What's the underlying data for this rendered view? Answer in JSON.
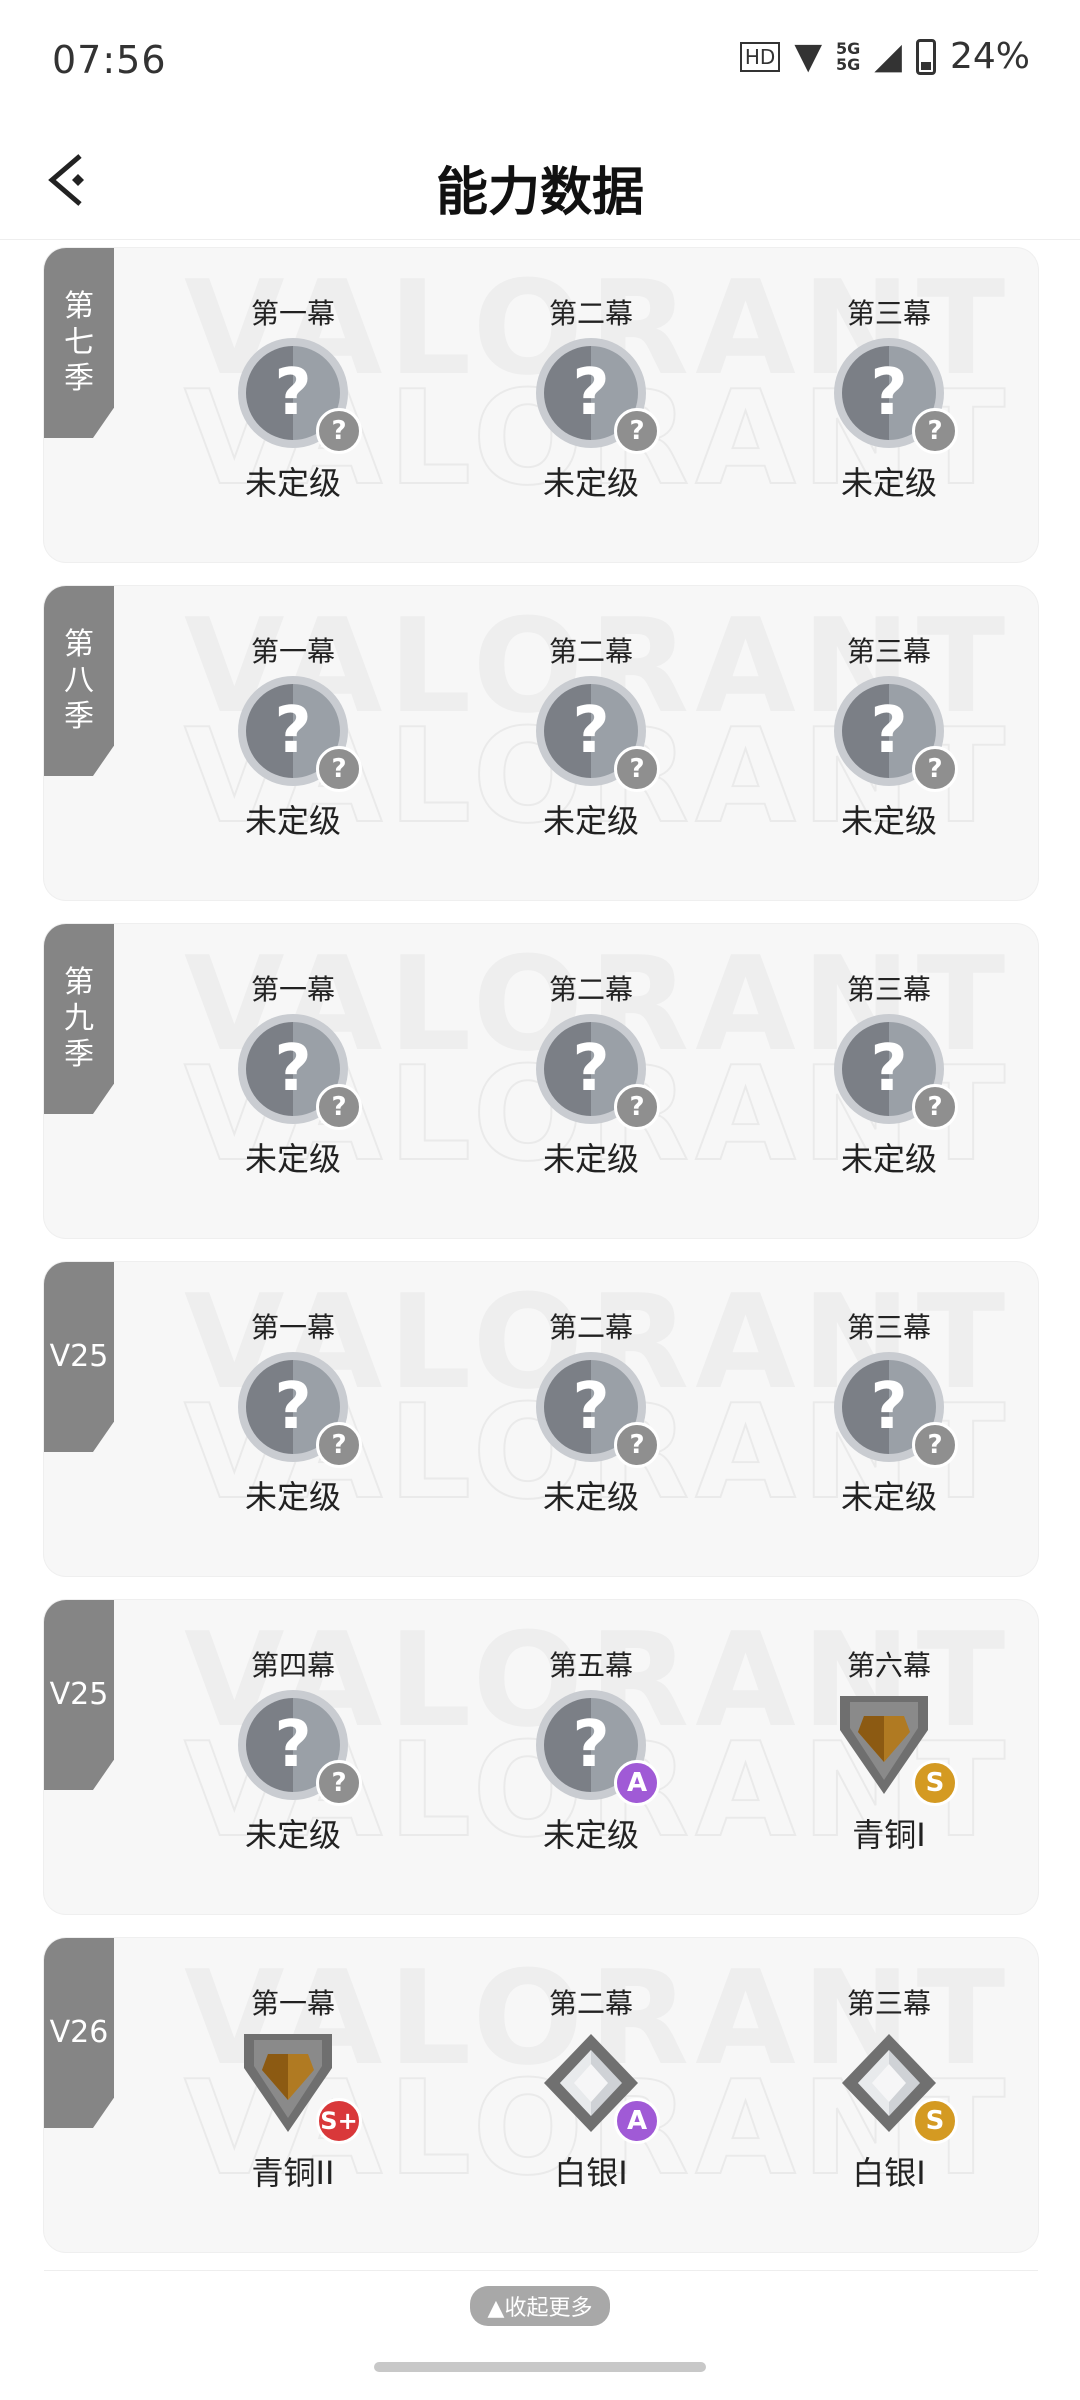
{
  "status": {
    "time": "07:56",
    "network": "5G",
    "battery": "24%"
  },
  "header": {
    "title": "能力数据"
  },
  "watermark": "VALORANT",
  "seasons": [
    {
      "tag": "第七季",
      "acts": [
        {
          "name": "第一幕",
          "rank": "未定级",
          "icon": "unrated",
          "badge": "?"
        },
        {
          "name": "第二幕",
          "rank": "未定级",
          "icon": "unrated",
          "badge": "?"
        },
        {
          "name": "第三幕",
          "rank": "未定级",
          "icon": "unrated",
          "badge": "?"
        }
      ]
    },
    {
      "tag": "第八季",
      "acts": [
        {
          "name": "第一幕",
          "rank": "未定级",
          "icon": "unrated",
          "badge": "?"
        },
        {
          "name": "第二幕",
          "rank": "未定级",
          "icon": "unrated",
          "badge": "?"
        },
        {
          "name": "第三幕",
          "rank": "未定级",
          "icon": "unrated",
          "badge": "?"
        }
      ]
    },
    {
      "tag": "第九季",
      "acts": [
        {
          "name": "第一幕",
          "rank": "未定级",
          "icon": "unrated",
          "badge": "?"
        },
        {
          "name": "第二幕",
          "rank": "未定级",
          "icon": "unrated",
          "badge": "?"
        },
        {
          "name": "第三幕",
          "rank": "未定级",
          "icon": "unrated",
          "badge": "?"
        }
      ]
    },
    {
      "tag": "V25",
      "acts": [
        {
          "name": "第一幕",
          "rank": "未定级",
          "icon": "unrated",
          "badge": "?"
        },
        {
          "name": "第二幕",
          "rank": "未定级",
          "icon": "unrated",
          "badge": "?"
        },
        {
          "name": "第三幕",
          "rank": "未定级",
          "icon": "unrated",
          "badge": "?"
        }
      ]
    },
    {
      "tag": "V25",
      "acts": [
        {
          "name": "第四幕",
          "rank": "未定级",
          "icon": "unrated",
          "badge": "?"
        },
        {
          "name": "第五幕",
          "rank": "未定级",
          "icon": "unrated",
          "badge": "A"
        },
        {
          "name": "第六幕",
          "rank": "青铜I",
          "icon": "bronze",
          "badge": "S"
        }
      ]
    },
    {
      "tag": "V26",
      "acts": [
        {
          "name": "第一幕",
          "rank": "青铜II",
          "icon": "bronze",
          "badge": "S+"
        },
        {
          "name": "第二幕",
          "rank": "白银I",
          "icon": "silver",
          "badge": "A"
        },
        {
          "name": "第三幕",
          "rank": "白银I",
          "icon": "silver",
          "badge": "S"
        }
      ]
    }
  ],
  "footer": {
    "collapse_label": "▲收起更多"
  },
  "colors": {
    "tag_bg": "#858585",
    "badge_a": "#a05ad6",
    "badge_s": "#d49a22",
    "badge_splus": "#d9383a",
    "badge_q": "#8f8f8f"
  }
}
